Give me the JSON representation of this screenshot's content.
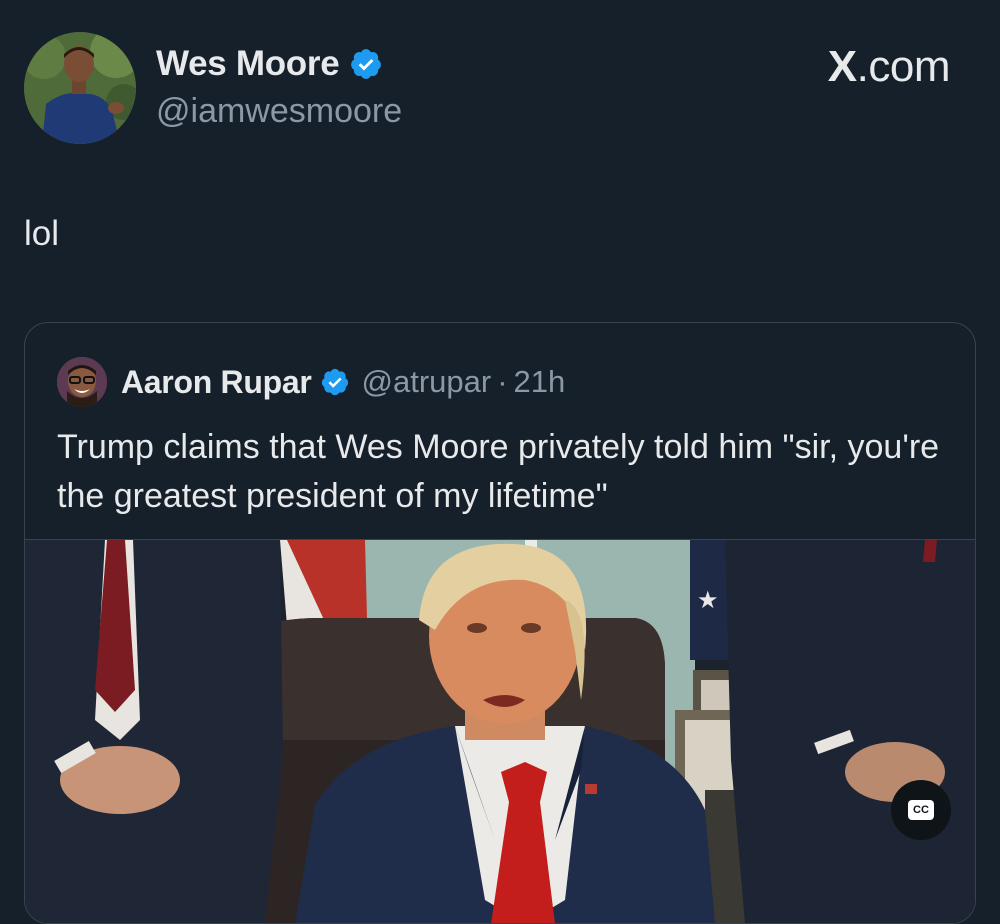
{
  "author": {
    "name": "Wes Moore",
    "handle": "@iamwesmoore",
    "avatar_icon": "wes-moore-avatar",
    "verified_icon": "verified-badge-icon"
  },
  "brand": {
    "prefix": "X",
    "suffix": ".com"
  },
  "tweet": {
    "text": "lol"
  },
  "quoted_tweet": {
    "name": "Aaron Rupar",
    "handle": "@atrupar",
    "separator": "·",
    "time": "21h",
    "text": "Trump claims that Wes Moore privately told him \"sir, you're the greatest president of my lifetime\"",
    "media": {
      "cc_label": "CC",
      "cc_icon": "closed-captions-icon"
    }
  },
  "colors": {
    "background": "#15202b",
    "verified": "#1d9bf0",
    "secondary_text": "#8b98a5",
    "border": "#38444d"
  }
}
